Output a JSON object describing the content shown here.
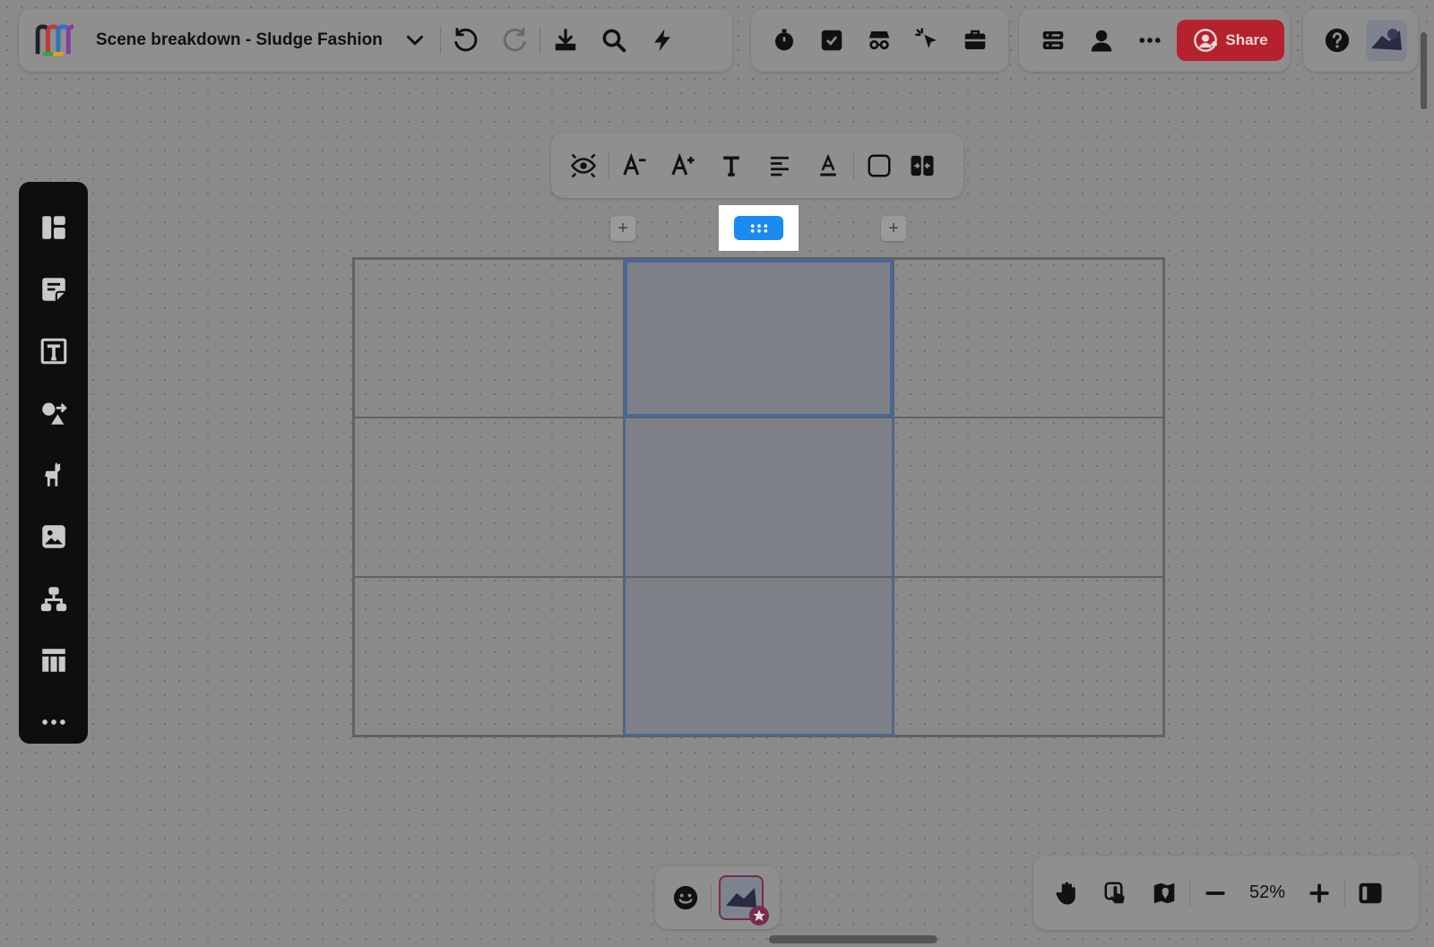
{
  "header": {
    "board_title": "Scene breakdown - Sludge Fashion",
    "share_label": "Share"
  },
  "icons": {
    "logo": "miro-logo",
    "title_dropdown": "chevron-down-icon",
    "undo": "undo-icon",
    "redo": "redo-icon",
    "export": "download-icon",
    "search": "search-icon",
    "actions": "lightning-icon",
    "timer": "timer-icon",
    "voting": "checkbox-icon",
    "private_mode": "incognito-icon",
    "attention": "cursor-icon",
    "toolbox": "toolbox-icon",
    "board_menu": "list-icon",
    "user": "user-icon",
    "more": "more-icon",
    "help": "help-icon"
  },
  "sidebar": {
    "items": [
      "templates",
      "sticky-note",
      "text",
      "shapes",
      "llama",
      "image",
      "mindmap",
      "table",
      "more"
    ]
  },
  "format_toolbar": {
    "items": [
      "focus-view",
      "font-decrease",
      "font-increase",
      "font-style",
      "align-left",
      "text-color",
      "cell-fill",
      "merge-cells"
    ]
  },
  "table": {
    "rows": 3,
    "columns": 3,
    "selected_column": 2,
    "colors": {
      "selection_border": "#4a6696",
      "handle": "#1a8cf0"
    }
  },
  "zoom": {
    "value": "52%"
  },
  "colors": {
    "share_button": "#b5222e",
    "sidebar_bg": "#0e0e0e"
  }
}
